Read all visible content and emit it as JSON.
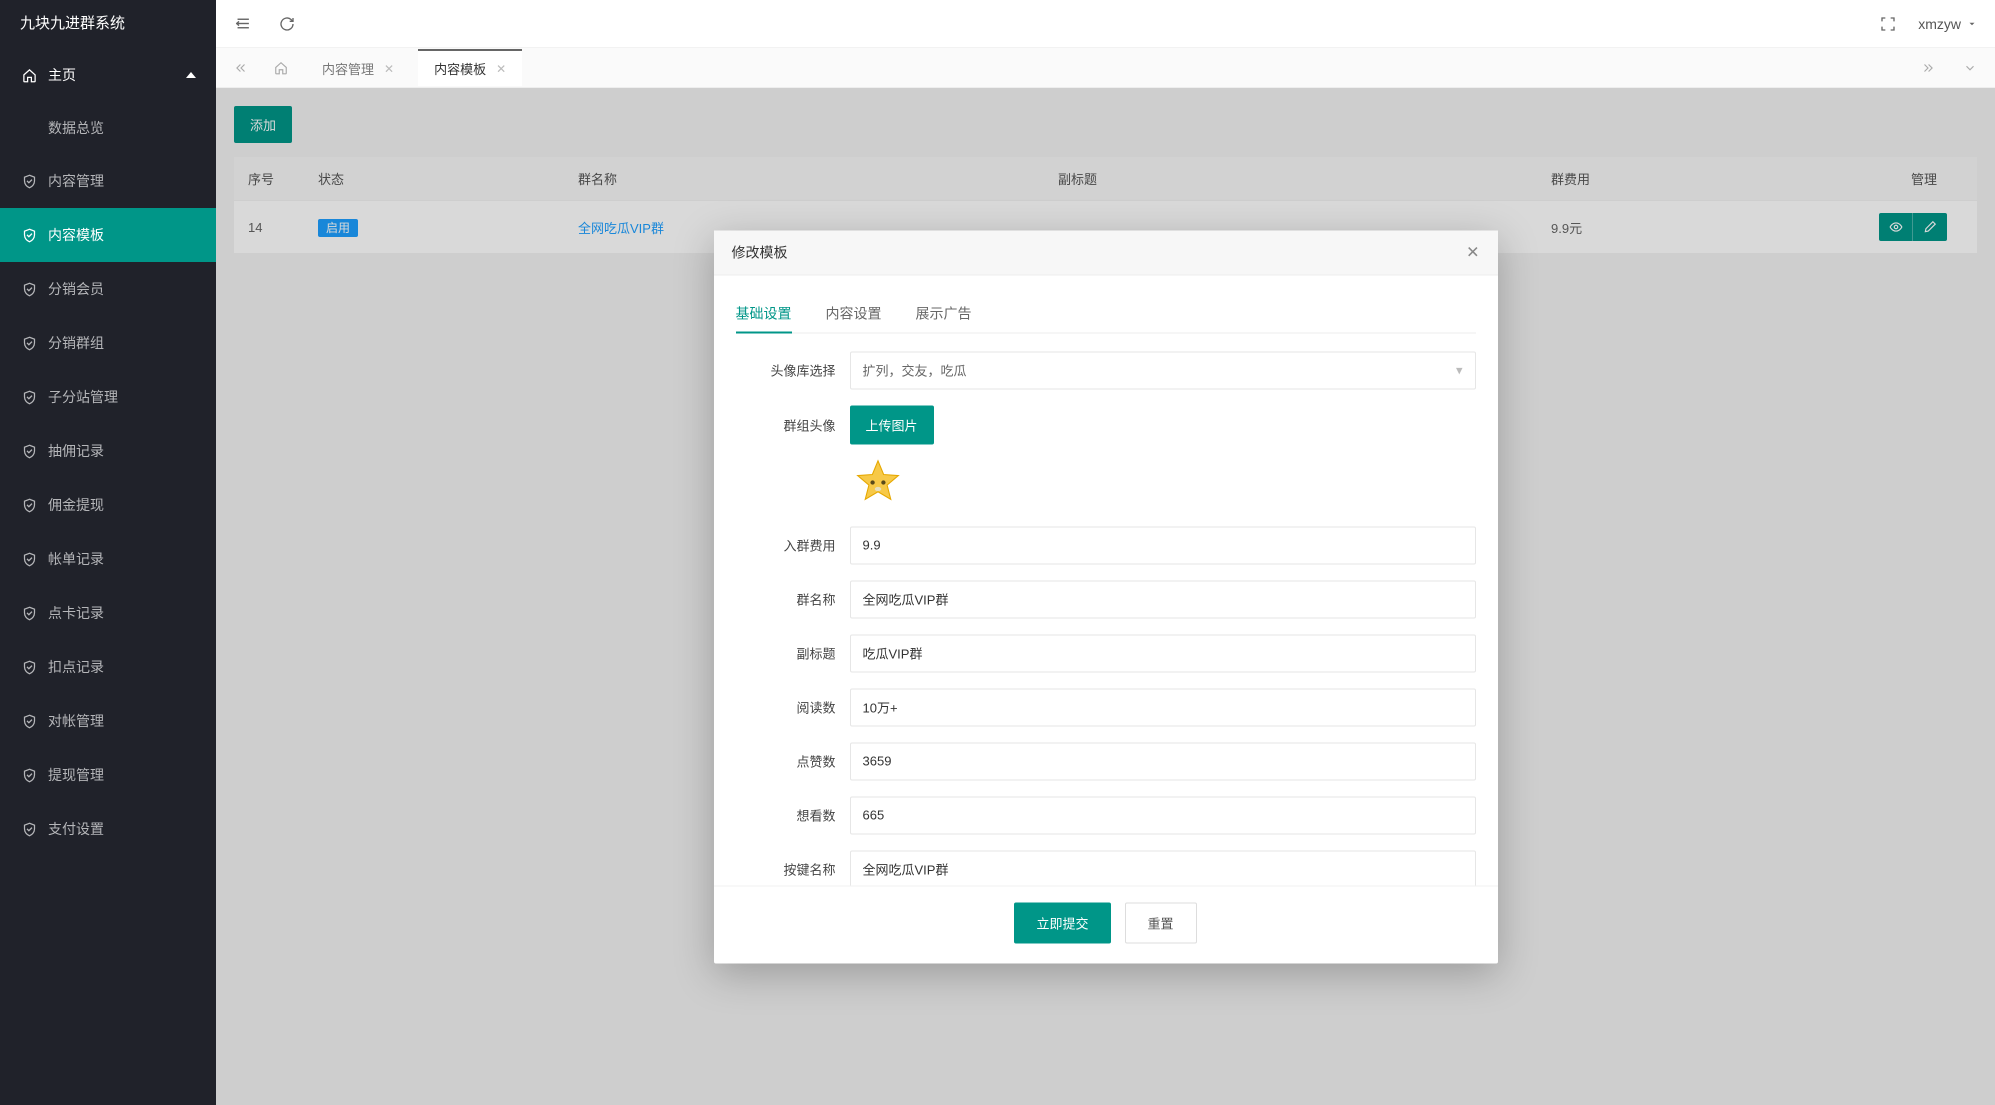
{
  "app": {
    "title": "九块九进群系统",
    "user": "xmzyw"
  },
  "sidebar": {
    "home": "主页",
    "items": [
      {
        "label": "数据总览"
      },
      {
        "label": "内容管理"
      },
      {
        "label": "内容模板"
      },
      {
        "label": "分销会员"
      },
      {
        "label": "分销群组"
      },
      {
        "label": "子分站管理"
      },
      {
        "label": "抽佣记录"
      },
      {
        "label": "佣金提现"
      },
      {
        "label": "帐单记录"
      },
      {
        "label": "点卡记录"
      },
      {
        "label": "扣点记录"
      },
      {
        "label": "对帐管理"
      },
      {
        "label": "提现管理"
      },
      {
        "label": "支付设置"
      }
    ]
  },
  "tabs": [
    {
      "label": "内容管理"
    },
    {
      "label": "内容模板"
    }
  ],
  "page": {
    "add_label": "添加",
    "columns": {
      "id": "序号",
      "status": "状态",
      "name": "群名称",
      "subtitle": "副标题",
      "fee": "群费用",
      "manage": "管理"
    },
    "row": {
      "id": "14",
      "status": "启用",
      "name": "全网吃瓜VIP群",
      "subtitle": "",
      "fee": "9.9元"
    }
  },
  "modal": {
    "title": "修改模板",
    "tabs": {
      "basic": "基础设置",
      "content": "内容设置",
      "ad": "展示广告"
    },
    "labels": {
      "avatar_lib": "头像库选择",
      "group_avatar": "群组头像",
      "upload": "上传图片",
      "fee": "入群费用",
      "name": "群名称",
      "subtitle": "副标题",
      "reads": "阅读数",
      "likes": "点赞数",
      "want": "想看数",
      "button_name": "按键名称"
    },
    "values": {
      "avatar_lib": "扩列，交友，吃瓜",
      "fee": "9.9",
      "name": "全网吃瓜VIP群",
      "subtitle": "吃瓜VIP群",
      "reads": "10万+",
      "likes": "3659",
      "want": "665",
      "button_name": "全网吃瓜VIP群"
    },
    "footer": {
      "submit": "立即提交",
      "reset": "重置"
    }
  }
}
